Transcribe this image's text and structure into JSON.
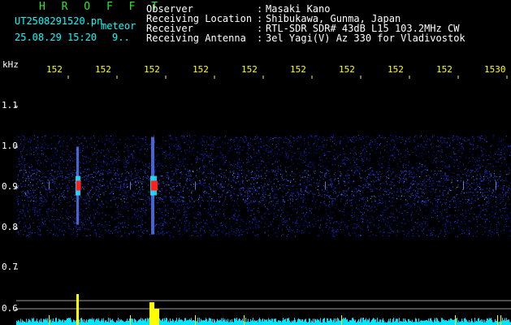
{
  "app": {
    "title": "H R O F F T",
    "filename": "UT2508291520.pn",
    "meteor_label": "meteor",
    "datetime": "25.08.29 15:20",
    "count": "9.."
  },
  "header": {
    "labels": [
      "Observer",
      "Receiving Location",
      "Receiver",
      "Receiving Antenna"
    ],
    "colons": [
      ":",
      ":",
      ":",
      ":"
    ],
    "values": [
      "Masaki Kano",
      "Shibukawa, Gunma, Japan",
      "RTL-SDR SDR# 43dB L15 103.2MHz CW",
      "3el Yagi(V) Az 330 for Vladivostok"
    ]
  },
  "axes": {
    "y_unit": "kHz",
    "y_ticks": [
      "1.1",
      "1.0",
      "0.9",
      "0.8",
      "0.7",
      "0.6"
    ],
    "x_ticks": [
      "152",
      "152",
      "152",
      "152",
      "152",
      "152",
      "152",
      "152",
      "152",
      "1530"
    ]
  },
  "colors": {
    "background": "#000000",
    "header_text": "#ffffff",
    "title_green": "#2ee82e",
    "filename_cyan": "#00ffff",
    "tick_yellow": "#ffff00",
    "noise_blue": "#1a2cff",
    "meteor_red": "#ff2020",
    "level_cyan": "#00e5ff",
    "level_yellow": "#ffff00"
  },
  "signal": {
    "band_center_khz": 0.905,
    "band_half_width_khz": 0.125,
    "meteor_echoes": [
      {
        "time_index": 1,
        "strength": 0.6
      },
      {
        "time_index": 2.6,
        "strength": 1.0
      }
    ]
  }
}
